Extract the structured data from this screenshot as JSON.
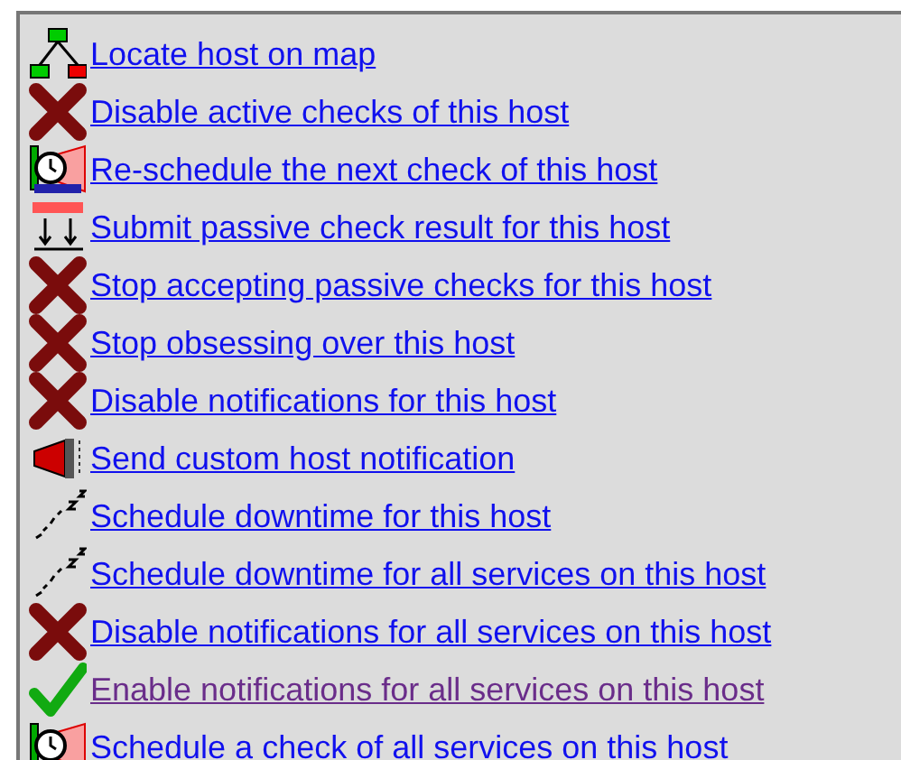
{
  "commands": [
    {
      "kind": "map",
      "label": "Locate host on map",
      "visited": false
    },
    {
      "kind": "cross",
      "label": "Disable active checks of this host",
      "visited": false
    },
    {
      "kind": "clock",
      "label": "Re-schedule the next check of this host",
      "visited": false
    },
    {
      "kind": "passive",
      "label": "Submit passive check result for this host",
      "visited": false
    },
    {
      "kind": "cross",
      "label": "Stop accepting passive checks for this host",
      "visited": false
    },
    {
      "kind": "cross",
      "label": "Stop obsessing over this host",
      "visited": false
    },
    {
      "kind": "cross",
      "label": "Disable notifications for this host",
      "visited": false
    },
    {
      "kind": "megaphone",
      "label": "Send custom host notification",
      "visited": false
    },
    {
      "kind": "sleep",
      "label": "Schedule downtime for this host",
      "visited": false
    },
    {
      "kind": "sleep",
      "label": "Schedule downtime for all services on this host",
      "visited": false
    },
    {
      "kind": "cross",
      "label": "Disable notifications for all services on this host",
      "visited": false
    },
    {
      "kind": "tick",
      "label": "Enable notifications for all services on this host",
      "visited": true
    },
    {
      "kind": "clock",
      "label": "Schedule a check of all services on this host",
      "visited": false
    }
  ]
}
